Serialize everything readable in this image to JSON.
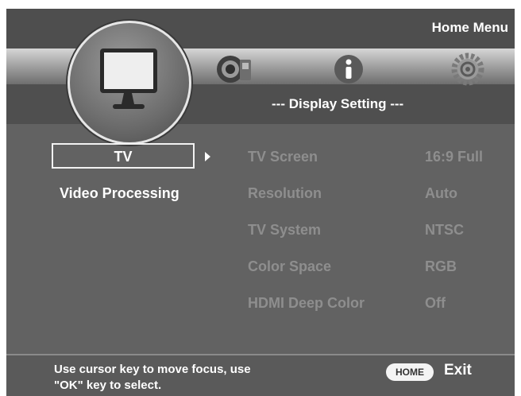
{
  "header": {
    "home_menu": "Home Menu",
    "section_title": "--- Display Setting ---"
  },
  "top_icons": [
    "tv-monitor-icon",
    "speaker-icon",
    "info-icon",
    "gear-icon"
  ],
  "left_menu": {
    "items": [
      {
        "label": "TV",
        "selected": true
      },
      {
        "label": "Video Processing",
        "selected": false
      }
    ]
  },
  "settings": [
    {
      "name": "TV Screen",
      "value": "16:9 Full"
    },
    {
      "name": "Resolution",
      "value": "Auto"
    },
    {
      "name": "TV System",
      "value": "NTSC"
    },
    {
      "name": "Color Space",
      "value": "RGB"
    },
    {
      "name": "HDMI Deep Color",
      "value": "Off"
    }
  ],
  "footer": {
    "hint_line1": "Use cursor key to move focus, use",
    "hint_line2": "\"OK\" key to select.",
    "home_key": "HOME",
    "exit_label": "Exit"
  },
  "colors": {
    "background": "#626262",
    "active_text": "#ffffff",
    "inactive_text": "#8e8e8e"
  }
}
